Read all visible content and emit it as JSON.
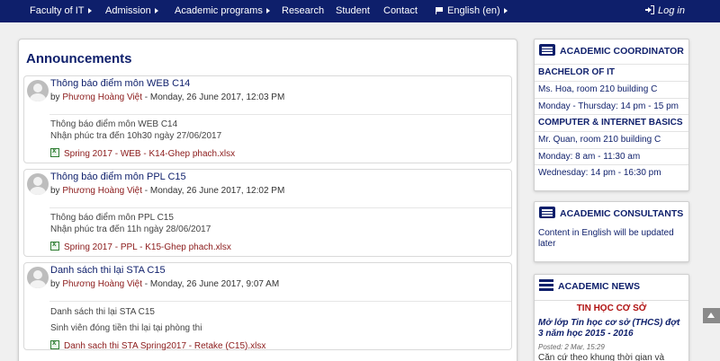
{
  "nav": {
    "items": [
      {
        "label": "Faculty of IT",
        "caret": true
      },
      {
        "label": "Admission",
        "caret": true
      },
      {
        "label": "Academic programs",
        "caret": true
      },
      {
        "label": "Research",
        "caret": false
      },
      {
        "label": "Student",
        "caret": false
      },
      {
        "label": "Contact",
        "caret": false
      }
    ],
    "language": "English (en)",
    "login": "Log in"
  },
  "main": {
    "title": "Announcements",
    "posts": [
      {
        "title": "Thông báo điểm môn WEB C14",
        "by": "by",
        "author": "Phương Hoàng Việt",
        "date": " - Monday, 26 June 2017, 12:03 PM",
        "lines": [
          "Thông báo điểm môn WEB C14",
          "Nhận phúc tra đến 10h30 ngày 27/06/2017"
        ],
        "attachment": "Spring 2017 - WEB - K14-Ghep phach.xlsx"
      },
      {
        "title": "Thông báo điểm môn PPL C15",
        "by": "by",
        "author": "Phương Hoàng Việt",
        "date": " - Monday, 26 June 2017, 12:02 PM",
        "lines": [
          "Thông báo điểm môn PPL C15",
          "Nhận phúc tra đến 11h ngày 28/06/2017"
        ],
        "attachment": "Spring 2017 - PPL - K15-Ghep phach.xlsx"
      },
      {
        "title": "Danh sách thi lại STA C15",
        "by": "by",
        "author": "Phương Hoàng Việt",
        "date": " - Monday, 26 June 2017, 9:07 AM",
        "lines": [
          "Danh sách thi lại STA C15",
          "Sinh viên đóng tiền thi lại tại phòng thi"
        ],
        "attachment": "Danh sach thi STA Spring2017 - Retake (C15).xlsx"
      }
    ]
  },
  "sidebar": {
    "coordinator": {
      "heading": "ACADEMIC COORDINATOR",
      "rows": [
        "BACHELOR OF IT",
        "Ms. Hoa, room 210 building C",
        "Monday - Thursday: 14 pm - 15 pm",
        "COMPUTER & INTERNET BASICS",
        "Mr. Quan, room 210 building C",
        "Monday: 8 am - 11:30 am",
        "Wednesday: 14 pm - 16:30 pm"
      ]
    },
    "consultants": {
      "heading": "ACADEMIC CONSULTANTS",
      "text": "Content in English will be updated later"
    },
    "news": {
      "heading": "ACADEMIC NEWS",
      "category": "TIN HỌC CƠ SỞ",
      "title": "Mở lớp Tin học cơ sở (THCS) đợt 3 năm học 2015 - 2016",
      "date": "Posted: 2 Mar, 15:29",
      "snippet": "Căn cứ theo khung thời gian và"
    }
  }
}
